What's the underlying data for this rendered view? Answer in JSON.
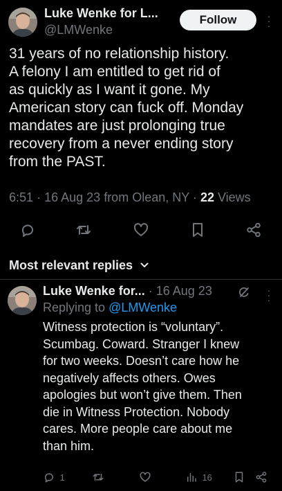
{
  "main_tweet": {
    "author_name": "Luke Wenke for L...",
    "author_handle": "@LMWenke",
    "follow_label": "Follow",
    "text_lines": [
      "31 years of no relationship history.",
      "A felony I am entitled to get rid of",
      "as quickly as I want it gone.  My",
      "American story can fuck off.  Monday",
      "mandates are just prolonging true",
      "recovery from a never ending story",
      "from the PAST."
    ],
    "time": "6:51",
    "date": "16 Aug 23",
    "source": "from Olean, NY",
    "views_count": "22",
    "views_label": "Views",
    "separator": "·"
  },
  "replies_header": {
    "label": "Most relevant replies"
  },
  "reply": {
    "author_name": "Luke Wenke for...",
    "separator": "·",
    "date": "16 Aug 23",
    "replying_prefix": "Replying to",
    "replying_handle": "@LMWenke",
    "text_lines": [
      "Witness protection is “voluntary”.",
      "Scumbag.  Coward.  Stranger I knew",
      "for two weeks.  Doesn’t care how he",
      "negatively affects others.  Owes",
      "apologies but won’t give them.  Then",
      "die in Witness Protection.  Nobody",
      "cares.  More people care about me",
      "than him."
    ],
    "reply_count": "1",
    "views_count": "16"
  },
  "icons": {
    "reply": "reply-icon",
    "retweet": "retweet-icon",
    "like": "heart-icon",
    "bookmark": "bookmark-icon",
    "share": "share-icon",
    "views": "views-icon",
    "more": "more-icon",
    "grok": "grok-icon",
    "chevron": "chevron-down-icon"
  },
  "colors": {
    "background": "#000000",
    "text": "#e7e9ea",
    "muted": "#71767b",
    "link": "#1d9bf0",
    "follow_button_bg": "#eff3f4",
    "divider": "#2f3336"
  }
}
